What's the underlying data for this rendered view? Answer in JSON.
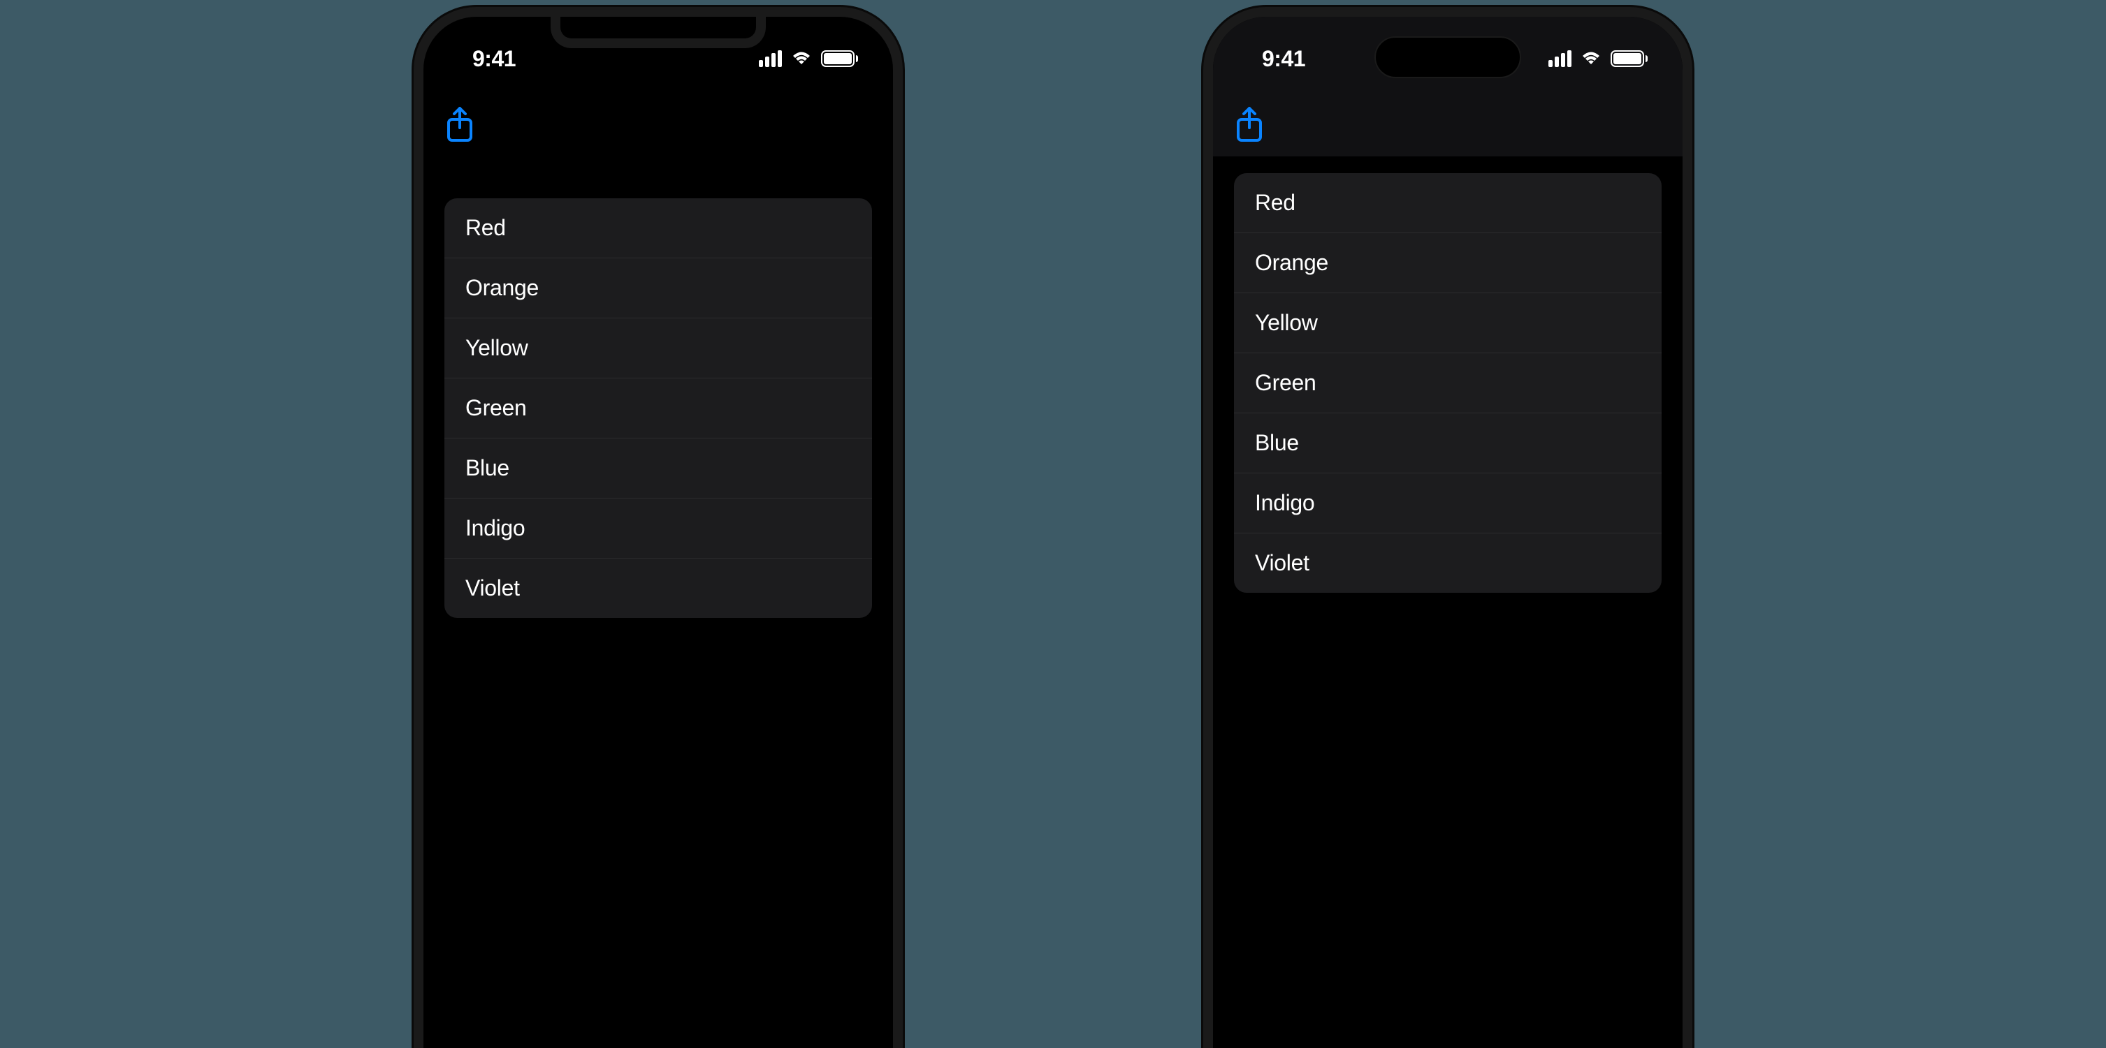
{
  "status": {
    "time": "9:41"
  },
  "list": {
    "items": [
      {
        "label": "Red"
      },
      {
        "label": "Orange"
      },
      {
        "label": "Yellow"
      },
      {
        "label": "Green"
      },
      {
        "label": "Blue"
      },
      {
        "label": "Indigo"
      },
      {
        "label": "Violet"
      }
    ]
  },
  "colors": {
    "tint": "#0a84ff"
  }
}
